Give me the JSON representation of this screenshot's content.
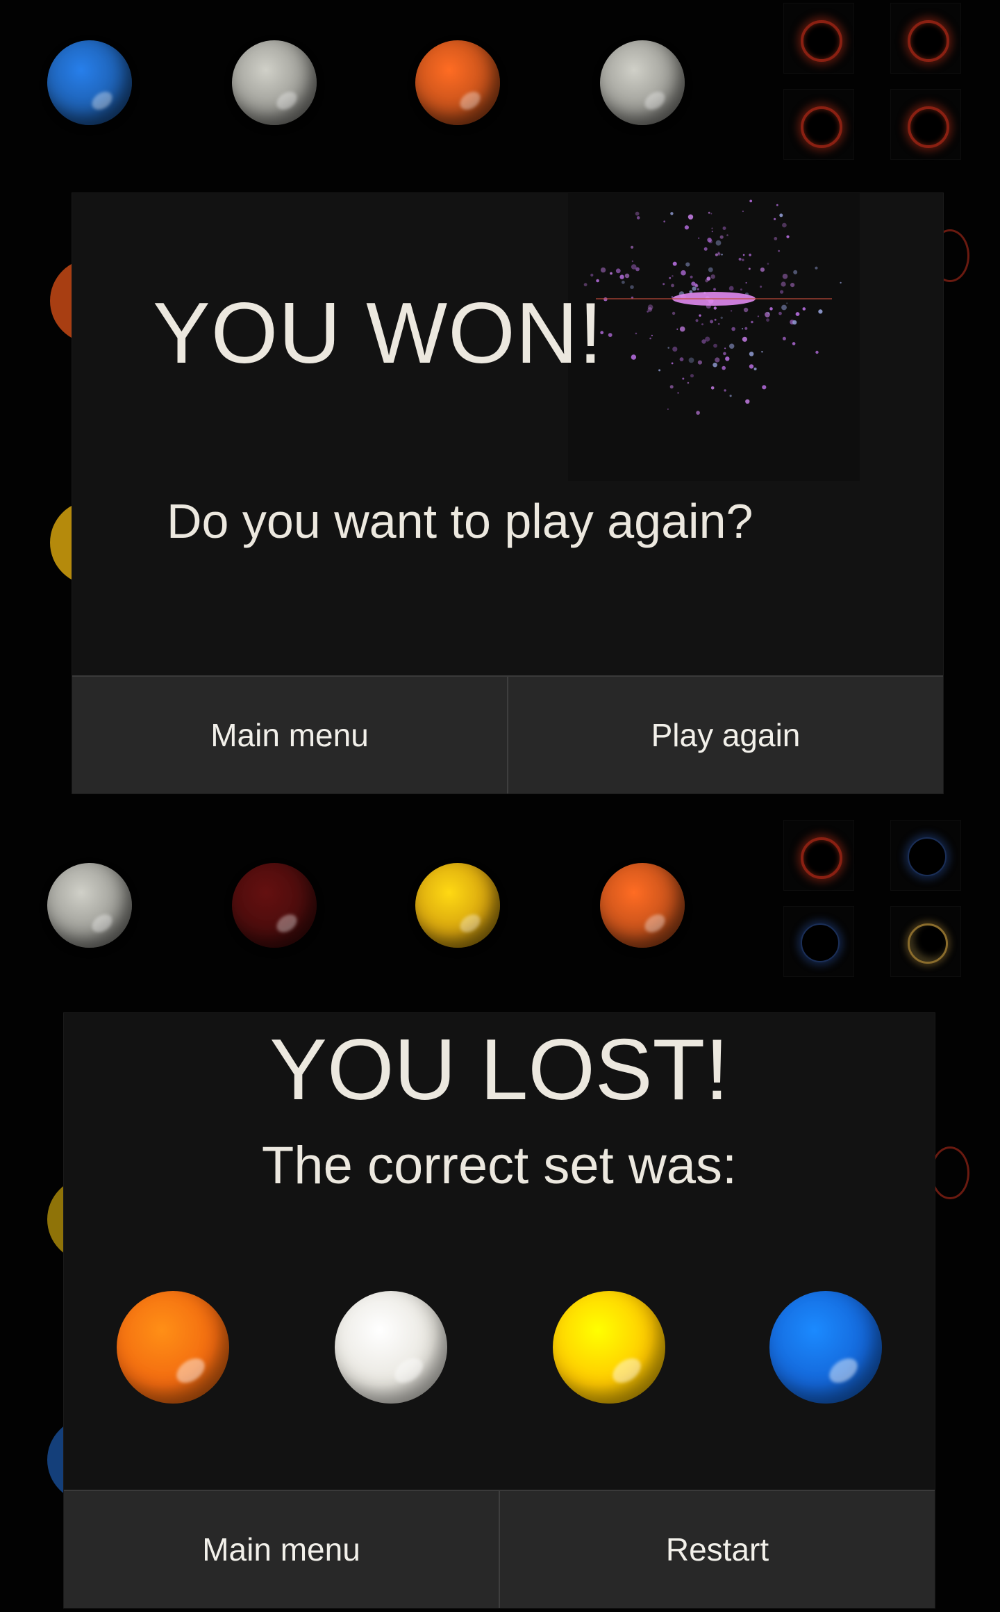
{
  "colors": {
    "blue": "#1d5eae",
    "gray": "#9a9a94",
    "orange": "#c2501a",
    "darkred": "#4a0c0c",
    "yellow": "#d4a10e",
    "white": "#e8e6df",
    "bright_orange": "#f26a10",
    "bright_yellow": "#ffc800",
    "bright_blue": "#1466d8"
  },
  "board": {
    "row_top": [
      "blue",
      "gray",
      "orange",
      "gray"
    ],
    "row_middle": [
      "gray",
      "darkred",
      "yellow",
      "orange"
    ],
    "pegs_top": [
      "red",
      "red",
      "red",
      "red"
    ],
    "pegs_middle": [
      "red",
      "blue",
      "blue",
      "gold"
    ]
  },
  "win_dialog": {
    "title": "YOU WON!",
    "subtitle": "Do you want to play again?",
    "main_menu_label": "Main menu",
    "play_again_label": "Play again"
  },
  "lose_dialog": {
    "title": "YOU LOST!",
    "subtitle": "The correct set was:",
    "correct_set": [
      "bright_orange",
      "white",
      "bright_yellow",
      "bright_blue"
    ],
    "main_menu_label": "Main menu",
    "restart_label": "Restart"
  }
}
